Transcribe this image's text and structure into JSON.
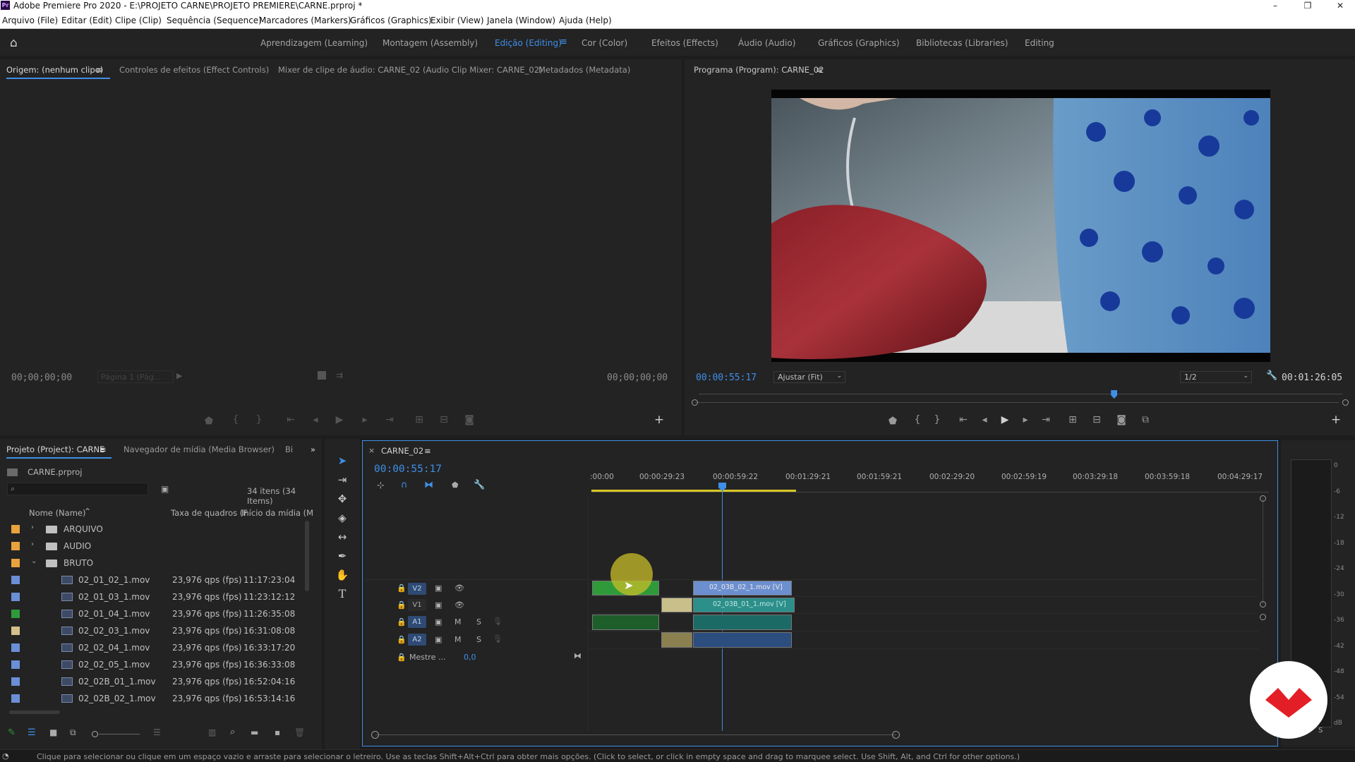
{
  "app": {
    "title": "Adobe Premiere Pro 2020 - E:\\PROJETO CARNE\\PROJETO PREMIERE\\CARNE.prproj *",
    "icon_text": "Pr",
    "window_buttons": {
      "minimize": "–",
      "maximize": "❐",
      "close": "✕"
    }
  },
  "menu": {
    "items": [
      "Arquivo (File)",
      "Editar (Edit)",
      "Clipe (Clip)",
      "Sequência (Sequence)",
      "Marcadores (Markers)",
      "Gráficos (Graphics)",
      "Exibir (View)",
      "Janela (Window)",
      "Ajuda (Help)"
    ]
  },
  "workspaces": {
    "items": [
      "Aprendizagem (Learning)",
      "Montagem (Assembly)",
      "Edição (Editing)",
      "Cor (Color)",
      "Efeitos (Effects)",
      "Áudio (Audio)",
      "Gráficos (Graphics)",
      "Bibliotecas (Libraries)",
      "Editing"
    ],
    "active_index": 2,
    "accent": "#3f8fe8"
  },
  "source_panel": {
    "tabs": [
      "Origem: (nenhum clipe)",
      "Controles de efeitos (Effect Controls)",
      "Mixer de clipe de áudio: CARNE_02 (Audio Clip Mixer: CARNE_02)",
      "Metadados (Metadata)"
    ],
    "timecode_left": "00;00;00;00",
    "page_select": "Página 1 (Pág...",
    "timecode_right": "00;00;00;00"
  },
  "program_panel": {
    "tab": "Programa (Program): CARNE_02",
    "timecode_current": "00:00:55:17",
    "fit_label": "Ajustar (Fit)",
    "resolution": "1/2",
    "timecode_duration": "00:01:26:05",
    "playhead_position": 0.645
  },
  "project_panel": {
    "tabs": [
      "Projeto (Project): CARNE",
      "Navegador de mídia (Media Browser)",
      "Bi"
    ],
    "project_file": "CARNE.prproj",
    "item_count": "34 itens (34 Items)",
    "columns": {
      "name": "Nome (Name)",
      "fps": "Taxa de quadros (F",
      "start": "Início da mídia (M"
    },
    "folders": [
      {
        "name": "ARQUIVO",
        "color": "#e8a33c",
        "expanded": false
      },
      {
        "name": "AUDIO",
        "color": "#e8a33c",
        "expanded": false
      },
      {
        "name": "BRUTO",
        "color": "#e8a33c",
        "expanded": true
      }
    ],
    "files": [
      {
        "name": "02_01_02_1.mov",
        "fps": "23,976 qps (fps)",
        "start": "11:17:23:04",
        "color": "#6b8fd6"
      },
      {
        "name": "02_01_03_1.mov",
        "fps": "23,976 qps (fps)",
        "start": "11:23:12:12",
        "color": "#6b8fd6"
      },
      {
        "name": "02_01_04_1.mov",
        "fps": "23,976 qps (fps)",
        "start": "11:26:35:08",
        "color": "#2e9a3a"
      },
      {
        "name": "02_02_03_1.mov",
        "fps": "23,976 qps (fps)",
        "start": "16:31:08:08",
        "color": "#d4c08a"
      },
      {
        "name": "02_02_04_1.mov",
        "fps": "23,976 qps (fps)",
        "start": "16:33:17:20",
        "color": "#6b8fd6"
      },
      {
        "name": "02_02_05_1.mov",
        "fps": "23,976 qps (fps)",
        "start": "16:36:33:08",
        "color": "#6b8fd6"
      },
      {
        "name": "02_02B_01_1.mov",
        "fps": "23,976 qps (fps)",
        "start": "16:52:04:16",
        "color": "#6b8fd6"
      },
      {
        "name": "02_02B_02_1.mov",
        "fps": "23,976 qps (fps)",
        "start": "16:53:14:16",
        "color": "#6b8fd6"
      }
    ]
  },
  "timeline": {
    "sequence_name": "CARNE_02",
    "timecode": "00:00:55:17",
    "ruler": [
      ":00:00",
      "00:00:29:23",
      "00:00:59:22",
      "00:01:29:21",
      "00:01:59:21",
      "00:02:29:20",
      "00:02:59:19",
      "00:03:29:18",
      "00:03:59:18",
      "00:04:29:17"
    ],
    "tracks": {
      "video": [
        "V2",
        "V1"
      ],
      "audio": [
        "A1",
        "A2"
      ],
      "mute": "M",
      "solo": "S",
      "master_label": "Mestre ...",
      "master_value": "0,0"
    },
    "clips": {
      "v2_clip": "02_03B_02_1.mov [V]",
      "v1_clip": "02_03B_01_1.mov [V]"
    }
  },
  "meter": {
    "labels": [
      "0",
      "-6",
      "-12",
      "-18",
      "-24",
      "-30",
      "-36",
      "-42",
      "-48",
      "-54",
      "dB"
    ],
    "solo_label": "S"
  },
  "status_bar": {
    "text": "Clique para selecionar ou clique em um espaço vazio e arraste para selecionar o letreiro. Use as teclas Shift+Alt+Ctrl para obter mais opções. (Click to select, or click in empty space and drag to marquee select. Use Shift, Alt, and Ctrl for other options.)"
  },
  "colors": {
    "accent": "#3f8fe8",
    "panel_bg": "#232323",
    "video_clip": "#6c8fd0",
    "audio_clip": "#2c8f8a",
    "green_clip": "#2e9a3a"
  }
}
